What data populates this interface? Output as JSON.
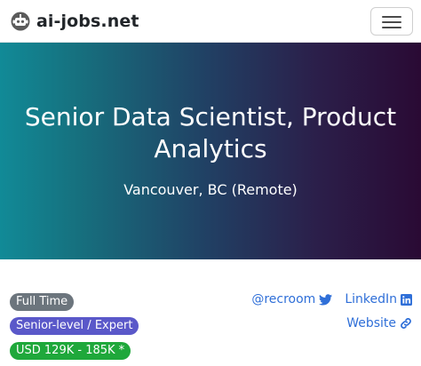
{
  "navbar": {
    "brand_text": "ai-jobs.net",
    "logo_icon": "robot-head-icon",
    "menu_icon": "hamburger-menu-icon"
  },
  "job": {
    "title": "Senior Data Scientist, Product Analytics",
    "location": "Vancouver, BC (Remote)"
  },
  "badges": {
    "employment_type": "Full Time",
    "level": "Senior-level / Expert",
    "salary": "USD 129K - 185K *"
  },
  "links": {
    "twitter": "@recroom",
    "linkedin": "LinkedIn",
    "website": "Website"
  },
  "colors": {
    "link": "#2f6fd8",
    "badge_type": "#6c757d",
    "badge_level": "#5a58c9",
    "badge_salary": "#1fa83b",
    "hero_start": "#118a97",
    "hero_end": "#2a0a34"
  }
}
